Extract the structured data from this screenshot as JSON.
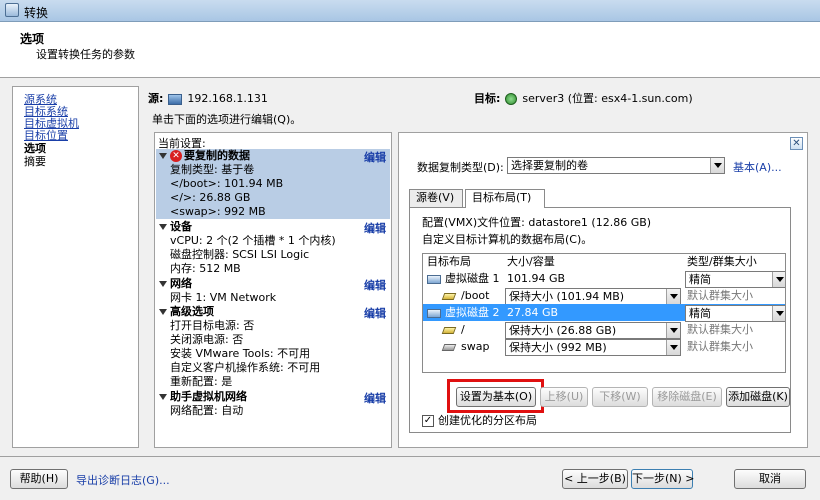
{
  "window": {
    "title": "转换"
  },
  "header": {
    "title": "选项",
    "subtitle": "设置转换任务的参数"
  },
  "nav": {
    "items": [
      {
        "label": "源系统",
        "state": "link"
      },
      {
        "label": "目标系统",
        "state": "link"
      },
      {
        "label": "目标虚拟机",
        "state": "link"
      },
      {
        "label": "目标位置",
        "state": "link"
      },
      {
        "label": "选项",
        "state": "current"
      },
      {
        "label": "摘要",
        "state": "plain"
      }
    ]
  },
  "source": {
    "label": "源:",
    "value": "192.168.1.131"
  },
  "target": {
    "label": "目标:",
    "value": "server3 (位置: esx4-1.sun.com)"
  },
  "hint": "单击下面的选项进行编辑(Q)。",
  "current_settings": {
    "caption": "当前设置:",
    "edit_label": "编辑",
    "sections": [
      {
        "title": "要复制的数据",
        "has_error": true,
        "selected": true,
        "lines": [
          "复制类型: 基于卷",
          "</boot>: 101.94 MB",
          "</>: 26.88 GB",
          "<swap>: 992 MB"
        ]
      },
      {
        "title": "设备",
        "lines": [
          "vCPU: 2 个(2 个插槽 * 1 个内核)",
          "磁盘控制器: SCSI LSI Logic",
          "内存: 512 MB"
        ]
      },
      {
        "title": "网络",
        "lines": [
          "网卡 1: VM Network"
        ]
      },
      {
        "title": "高级选项",
        "lines": [
          "打开目标电源: 否",
          "关闭源电源: 否",
          "安装 VMware Tools: 不可用",
          "自定义客户机操作系统: 不可用",
          "重新配置: 是"
        ]
      },
      {
        "title": "助手虚拟机网络",
        "lines": [
          "网络配置: 自动"
        ]
      }
    ]
  },
  "data_panel": {
    "copy_type_label": "数据复制类型(D):",
    "copy_type_value": "选择要复制的卷",
    "basic_link": "基本(A)...",
    "tabs": [
      "源卷(V)",
      "目标布局(T)"
    ],
    "active_tab": 1,
    "config_location": "配置(VMX)文件位置: datastore1 (12.86 GB)",
    "custom_layout": "自定义目标计算机的数据布局(C)。",
    "grid": {
      "columns": [
        "目标布局",
        "大小/容量",
        "类型/群集大小"
      ],
      "rows": [
        {
          "kind": "disk",
          "name": "虚拟磁盘 1",
          "size": "101.94 GB",
          "size_is_combo": false,
          "type": "精简",
          "type_is_combo": true,
          "selected": false
        },
        {
          "kind": "vol",
          "name": "/boot",
          "size": "保持大小 (101.94 MB)",
          "size_is_combo": true,
          "type": "默认群集大小",
          "type_is_combo": false,
          "selected": false
        },
        {
          "kind": "disk",
          "name": "虚拟磁盘 2",
          "size": "27.84 GB",
          "size_is_combo": false,
          "type": "精简",
          "type_is_combo": true,
          "selected": true
        },
        {
          "kind": "vol",
          "name": "/",
          "size": "保持大小 (26.88 GB)",
          "size_is_combo": true,
          "type": "默认群集大小",
          "type_is_combo": false,
          "selected": false
        },
        {
          "kind": "vol-grey",
          "name": "swap",
          "size": "保持大小 (992 MB)",
          "size_is_combo": true,
          "type": "默认群集大小",
          "type_is_combo": false,
          "selected": false
        }
      ]
    },
    "buttons": {
      "set_basic": "设置为基本(O)",
      "move_up": "上移(U)",
      "move_down": "下移(W)",
      "remove_disk": "移除磁盘(E)",
      "add_disk": "添加磁盘(K)"
    },
    "optimize_checkbox": {
      "label": "创建优化的分区布局",
      "checked": true
    }
  },
  "footer": {
    "help": "帮助(H)",
    "export_logs": "导出诊断日志(G)...",
    "back": "< 上一步(B)",
    "next": "下一步(N) >",
    "cancel": "取消"
  },
  "colors": {
    "selection": "#3399ff",
    "section_highlight": "#b9cde5",
    "link": "#1a3fa8",
    "annotation": "#e01010",
    "error": "#d82020"
  }
}
